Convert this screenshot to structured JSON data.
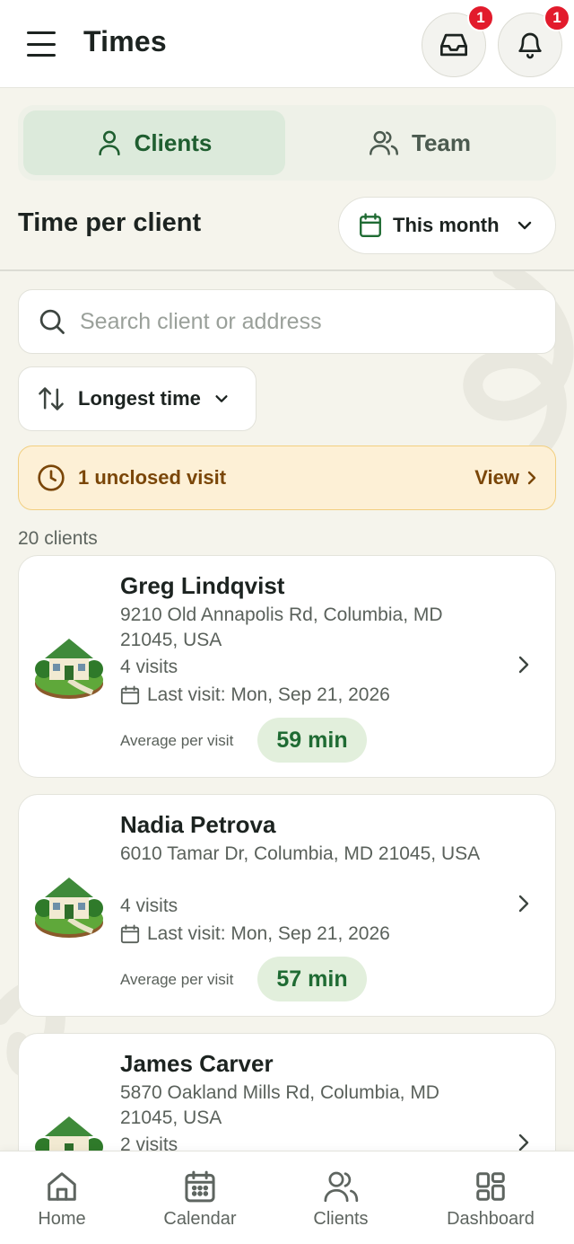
{
  "header": {
    "title": "Times",
    "inbox_badge": "1",
    "bell_badge": "1"
  },
  "tabs": [
    {
      "label": "Clients",
      "active": true
    },
    {
      "label": "Team",
      "active": false
    }
  ],
  "section": {
    "title": "Time per client",
    "period_label": "This month"
  },
  "search": {
    "placeholder": "Search client or address",
    "value": ""
  },
  "sort": {
    "label": "Longest time"
  },
  "alert": {
    "text": "1 unclosed visit",
    "action": "View"
  },
  "client_count": "20 clients",
  "clients": [
    {
      "name": "Greg Lindqvist",
      "address": "9210 Old Annapolis Rd, Columbia, MD 21045, USA",
      "visits": "4 visits",
      "last_visit": "Last visit: Mon, Sep 21, 2026",
      "avg_label": "Average per visit",
      "avg_value": "59 min"
    },
    {
      "name": "Nadia Petrova",
      "address": "6010 Tamar Dr, Columbia, MD 21045, USA",
      "visits": "4 visits",
      "last_visit": "Last visit: Mon, Sep 21, 2026",
      "avg_label": "Average per visit",
      "avg_value": "57 min"
    },
    {
      "name": "James Carver",
      "address": "5870 Oakland Mills Rd, Columbia, MD 21045, USA",
      "visits": "2 visits",
      "last_visit": "",
      "avg_label": "",
      "avg_value": ""
    }
  ],
  "nav": [
    {
      "label": "Home",
      "icon": "home-icon"
    },
    {
      "label": "Calendar",
      "icon": "calendar-icon"
    },
    {
      "label": "Clients",
      "icon": "users-icon"
    },
    {
      "label": "Dashboard",
      "icon": "dashboard-icon"
    }
  ],
  "colors": {
    "accent_green": "#1f6b33",
    "active_tab_bg": "#dceadb",
    "alert_bg": "#fdf0d6",
    "alert_text": "#7a4608",
    "badge_red": "#e21b2c"
  }
}
